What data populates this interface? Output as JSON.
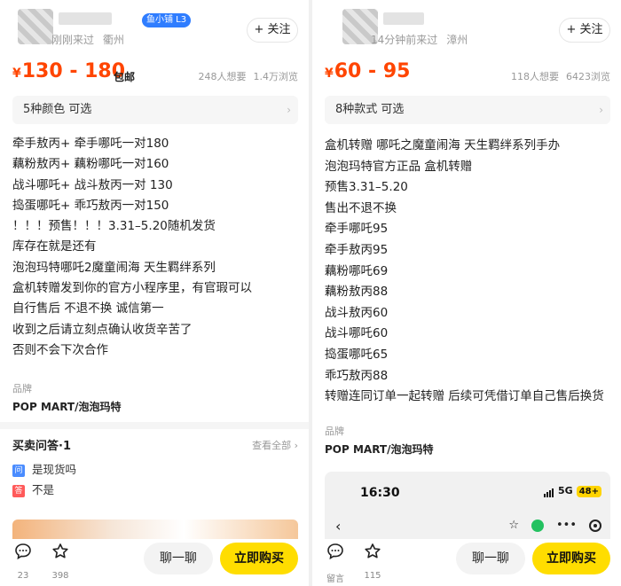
{
  "left": {
    "header": {
      "level_badge": "鱼小铺 L3",
      "visit_time": "刚刚来过",
      "location": "衢州",
      "follow_label": "+ 关注"
    },
    "price": {
      "currency": "¥",
      "amount": "130 - 180",
      "shipping": "包邮",
      "wants": "248人想要",
      "views": "1.4万浏览"
    },
    "option": "5种颜色 可选",
    "description": [
      "牵手敖丙+ 牵手哪吒一对180",
      "藕粉敖丙+ 藕粉哪吒一对160",
      "战斗哪吒+ 战斗敖丙一对 130",
      "捣蛋哪吒+ 乖巧敖丙一对150",
      "！！！预售！！！3.31–5.20随机发货",
      "库存在就是还有",
      "泡泡玛特哪吒2魔童闹海 天生羁绊系列",
      "盒机转赠发到你的官方小程序里，有官瑕可以",
      "自行售后 不退不换 诚信第一",
      "收到之后请立刻点确认收货辛苦了",
      "否则不会下次合作"
    ],
    "brand": {
      "label": "品牌",
      "value": "POP MART/泡泡玛特"
    },
    "qa": {
      "title": "买卖问答·1",
      "view_all": "查看全部",
      "question_tag": "问",
      "question": "是现货吗",
      "answer_tag": "答",
      "answer": "不是"
    },
    "bottom": {
      "comments_count": "23",
      "favorites_count": "398",
      "chat_label": "聊一聊",
      "buy_label": "立即购买"
    }
  },
  "right": {
    "header": {
      "visit_time": "14分钟前来过",
      "location": "漳州",
      "follow_label": "+ 关注"
    },
    "price": {
      "currency": "¥",
      "amount": "60 - 95",
      "wants": "118人想要",
      "views": "6423浏览"
    },
    "option": "8种款式 可选",
    "description": [
      "盒机转赠 哪吒之魔童闹海 天生羁绊系列手办",
      "泡泡玛特官方正品 盒机转赠",
      "预售3.31–5.20",
      "售出不退不换",
      "牵手哪吒95",
      "牵手敖丙95",
      "藕粉哪吒69",
      "藕粉敖丙88",
      "战斗敖丙60",
      "战斗哪吒60",
      "捣蛋哪吒65",
      "乖巧敖丙88",
      "转赠连同订单一起转赠 后续可凭借订单自己售后换货"
    ],
    "brand": {
      "label": "品牌",
      "value": "POP MART/泡泡玛特"
    },
    "phone": {
      "time": "16:30",
      "network": "5G",
      "battery": "48+"
    },
    "bottom": {
      "comments_label": "留言",
      "favorites_count": "115",
      "chat_label": "聊一聊",
      "buy_label": "立即购买"
    }
  },
  "colors": {
    "price": "#ff4500",
    "buy_button": "#ffdd00",
    "qa_question_tag": "#4a8cff",
    "qa_answer_tag": "#ff5a5a"
  }
}
